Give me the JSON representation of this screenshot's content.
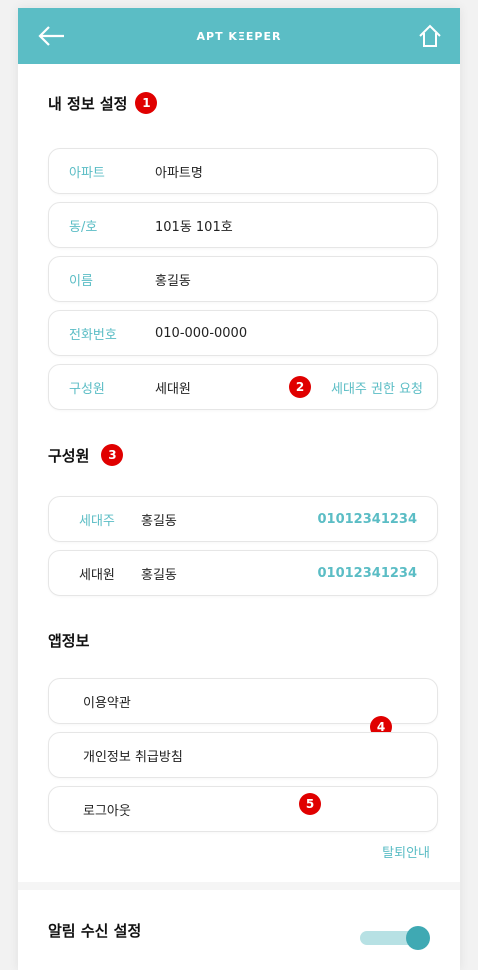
{
  "header": {
    "title": "APT KΞEPER"
  },
  "my_info": {
    "title": "내 정보 설정",
    "marker": "1",
    "rows": [
      {
        "label": "아파트",
        "value": "아파트명"
      },
      {
        "label": "동/호",
        "value": "101동 101호"
      },
      {
        "label": "이름",
        "value": "홍길동"
      },
      {
        "label": "전화번호",
        "value": "010-000-0000"
      },
      {
        "label": "구성원",
        "value": "세대원"
      }
    ],
    "request_link": "세대주 권한 요청",
    "request_marker": "2"
  },
  "members": {
    "title": "구성원",
    "marker": "3",
    "rows": [
      {
        "role": "세대주",
        "name": "홍길동",
        "phone": "01012341234"
      },
      {
        "role": "세대원",
        "name": "홍길동",
        "phone": "01012341234"
      }
    ]
  },
  "app_info": {
    "title": "앱정보",
    "rows": [
      {
        "label": "이용약관"
      },
      {
        "label": "개인정보 취급방침"
      },
      {
        "label": "로그아웃"
      }
    ],
    "marker_a": "4",
    "marker_b": "5",
    "withdraw_link": "탈퇴안내"
  },
  "notification": {
    "label": "알림 수신 설정",
    "enabled": true
  },
  "colors": {
    "accent": "#5bbdc5",
    "marker": "#e00000",
    "toggle_knob": "#3fa9b3",
    "toggle_track": "#b7e1e4"
  },
  "icons": {
    "back": "arrow-left-icon",
    "home": "home-icon"
  }
}
